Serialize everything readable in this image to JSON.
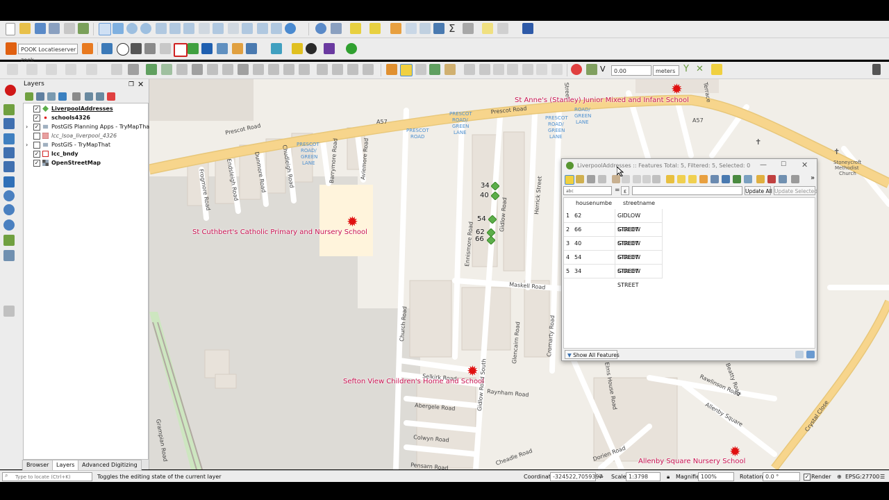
{
  "app": {
    "accent": "#2e7bcf",
    "brand": "#589632"
  },
  "toolbar2": {
    "locator_combo": "POOK Locatieserver zoek"
  },
  "toolbar3": {
    "snap_value": "0.00",
    "snap_unit": "meters"
  },
  "layers_panel": {
    "title": "Layers",
    "items": [
      {
        "label": "LiverpoolAddresses",
        "checked": true,
        "expand": "",
        "bold": true,
        "underline": true
      },
      {
        "label": "schools4326",
        "checked": true,
        "expand": "",
        "bold": true
      },
      {
        "label": "PostGIS Planning Apps - TryMapThat",
        "checked": true,
        "expand": "›"
      },
      {
        "label": "lcc_lsoa_liverpool_4326",
        "checked": false,
        "expand": "",
        "italic": true
      },
      {
        "label": "PostGIS - TryMapThat",
        "checked": false,
        "expand": "›"
      },
      {
        "label": "lcc_bndy",
        "checked": true,
        "expand": "",
        "bold": true
      },
      {
        "label": "OpenStreetMap",
        "checked": true,
        "expand": "",
        "bold": true
      }
    ],
    "tabs": [
      "Browser",
      "Layers",
      "Advanced Digitizing"
    ]
  },
  "map": {
    "roads": [
      "Prescot Road",
      "Prescot Road",
      "A57",
      "A57",
      "Frogmore Road",
      "Endsleigh Road",
      "Dunmore Road",
      "Chudleigh Road",
      "Barrymore Road",
      "Aviemore Road",
      "Gidlow Road",
      "Herrick Street",
      "Ennismore Road",
      "Maskell Road",
      "Church Road",
      "Glencairn Road",
      "Cromarty Road",
      "Selkirk Road",
      "Raynham Road",
      "Abergele Road",
      "Colwyn Road",
      "Pensarn Road",
      "Gidlow Road South",
      "Elms House Road",
      "Rawlinson Road",
      "Allenby Square",
      "Crystal Close",
      "Dorien Road",
      "Grampian Road",
      "Beatty Road",
      "Cheadle Road",
      "Terrace",
      "Street"
    ],
    "bus_stops": [
      "PRESCOT ROAD/ GREEN LANE",
      "PRESCOT ROAD",
      "PRESCOT ROAD/ GREEN LANE",
      "PRESCOT ROAD/ GREEN LANE",
      "ROAD/ GREEN LANE"
    ],
    "places": [
      "Stoneycroft Methodist Church"
    ],
    "schools": [
      {
        "name": "St Anne's (Stanley) Junior Mixed and Infant School"
      },
      {
        "name": "St Cuthbert's Catholic Primary and Nursery School"
      },
      {
        "name": "Sefton View Children's Home and School"
      },
      {
        "name": "Allenby Square Nursery School"
      }
    ],
    "address_points": [
      "34",
      "40",
      "54",
      "62",
      "66"
    ]
  },
  "attribute_table": {
    "title": "LiverpoolAddresses :: Features Total: 5, Filtered: 5, Selected: 0",
    "field_combo": "housenumbe",
    "field_prefix": "abc",
    "equals": "=",
    "expression_icon": "ε",
    "update_all": "Update All",
    "update_selected": "Update Selected",
    "columns": [
      "housenumbe",
      "streetname"
    ],
    "rows": [
      {
        "id": "1",
        "housenumbe": "62",
        "streetname": "GIDLOW STREET"
      },
      {
        "id": "2",
        "housenumbe": "66",
        "streetname": "GIDLOW STREET"
      },
      {
        "id": "3",
        "housenumbe": "40",
        "streetname": "GIDLOW STREET"
      },
      {
        "id": "4",
        "housenumbe": "54",
        "streetname": "GIDLOW STREET"
      },
      {
        "id": "5",
        "housenumbe": "34",
        "streetname": "GIDLOW STREET"
      }
    ],
    "show_all": "Show All Features",
    "overflow": "»"
  },
  "status_bar": {
    "locator_placeholder": "Type to locate (Ctrl+K)",
    "message": "Toggles the editing state of the current layer",
    "coordinate_label": "Coordinate",
    "coordinate_value": "-324522,7059397",
    "scale_label": "Scale",
    "scale_value": "1:3798",
    "magnifier_label": "Magnifier",
    "magnifier_value": "100%",
    "rotation_label": "Rotation",
    "rotation_value": "0.0 °",
    "render_label": "Render",
    "crs": "EPSG:27700"
  }
}
